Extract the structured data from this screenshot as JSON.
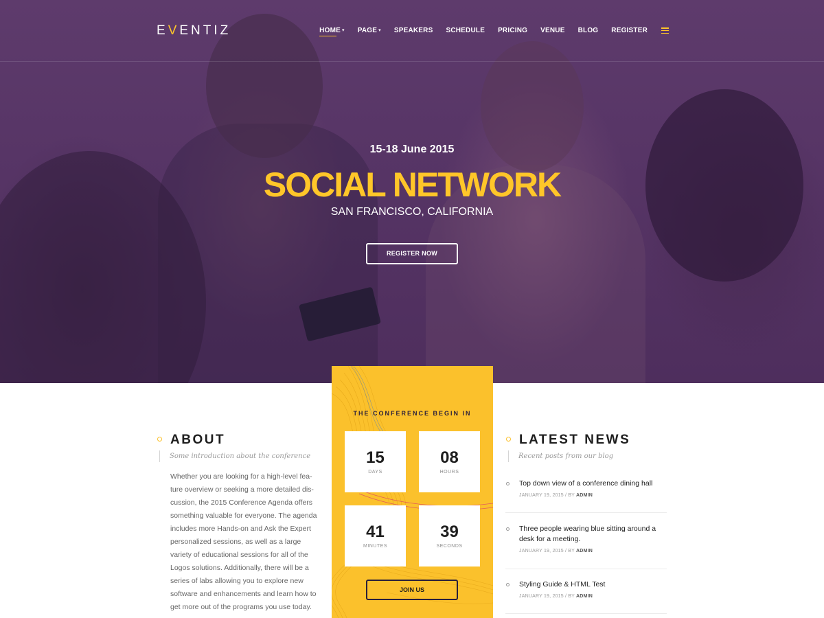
{
  "brand": {
    "logo_pre": "E",
    "logo_v": "V",
    "logo_post": "ENTIZ"
  },
  "nav": {
    "items": [
      {
        "label": "HOME",
        "has_dropdown": true,
        "active": true
      },
      {
        "label": "PAGE",
        "has_dropdown": true,
        "active": false
      },
      {
        "label": "SPEAKERS",
        "has_dropdown": false,
        "active": false
      },
      {
        "label": "SCHEDULE",
        "has_dropdown": false,
        "active": false
      },
      {
        "label": "PRICING",
        "has_dropdown": false,
        "active": false
      },
      {
        "label": "VENUE",
        "has_dropdown": false,
        "active": false
      },
      {
        "label": "BLOG",
        "has_dropdown": false,
        "active": false
      },
      {
        "label": "REGISTER",
        "has_dropdown": false,
        "active": false
      }
    ],
    "menu_icon": "hamburger-icon"
  },
  "hero": {
    "date": "15-18 June 2015",
    "title": "SOCIAL NETWORK",
    "location": "SAN FRANCISCO, CALIFORNIA",
    "cta_label": "REGISTER NOW"
  },
  "countdown": {
    "title": "THE CONFERENCE BEGIN IN",
    "units": [
      {
        "value": "15",
        "label": "DAYS"
      },
      {
        "value": "08",
        "label": "HOURS"
      },
      {
        "value": "41",
        "label": "MINUTES"
      },
      {
        "value": "39",
        "label": "SECONDS"
      }
    ],
    "cta_label": "JOIN US"
  },
  "about": {
    "title": "ABOUT",
    "subtitle": "Some introduction about the conference",
    "text": "Whether you are looking for a high-level fea-ture overview or seeking a more detailed dis-cussion, the 2015 Conference Agenda offers something valuable for everyone. The agenda includes more Hands-on and Ask the Expert personalized sessions, as well as a large variety of educational sessions for all of the Logos solutions. Additionally, there will be a series of labs allowing you to explore new software and enhancements and learn how to get more out of the programs you use today."
  },
  "news": {
    "title": "LATEST NEWS",
    "subtitle": "Recent posts from our blog",
    "posts": [
      {
        "title": "Top down view of a conference dining hall",
        "date": "JANUARY 19, 2015",
        "by": "/ BY",
        "author": "ADMIN"
      },
      {
        "title": "Three people wearing blue sitting around a desk for a meeting.",
        "date": "JANUARY 19, 2015",
        "by": "/ BY",
        "author": "ADMIN"
      },
      {
        "title": "Styling Guide & HTML Test",
        "date": "JANUARY 19, 2015",
        "by": "/ BY",
        "author": "ADMIN"
      }
    ]
  },
  "colors": {
    "accent": "#fbc12c",
    "hero_overlay": "#573566",
    "dark": "#1e1e1e"
  }
}
